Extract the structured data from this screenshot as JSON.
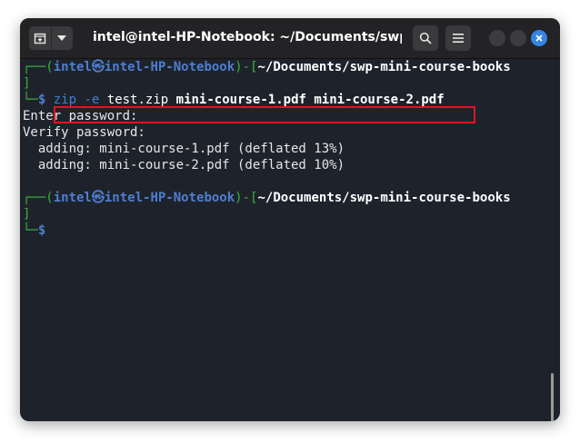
{
  "window": {
    "title": "intel@intel-HP-Notebook: ~/Documents/swp...",
    "new_tab_icon": "new-tab-icon",
    "menu_dropdown_icon": "chevron-down-icon",
    "search_icon": "search-icon",
    "hamburger_icon": "hamburger-menu-icon",
    "close_icon": "close-icon"
  },
  "prompt1": {
    "corner_top": "┌──(",
    "user": "intel",
    "symbol": "㉿",
    "host": "intel-HP-Notebook",
    "sep": ")-[",
    "path": "~/Documents/swp-mini-course-books",
    "bar": "]",
    "corner_bottom": "└─",
    "dollar": "$",
    "command": {
      "cmd": "zip",
      "flag": "-e",
      "archive": "test.zip",
      "file1": "mini-course-1.pdf",
      "file2": "mini-course-2.pdf"
    }
  },
  "output": [
    "Enter password:",
    "Verify password:",
    "  adding: mini-course-1.pdf (deflated 13%)",
    "  adding: mini-course-2.pdf (deflated 10%)"
  ],
  "prompt2": {
    "corner_top": "┌──(",
    "user": "intel",
    "symbol": "㉿",
    "host": "intel-HP-Notebook",
    "sep": ")-[",
    "path": "~/Documents/swp-mini-course-books",
    "bar": "]",
    "corner_bottom": "└─",
    "dollar": "$"
  },
  "colors": {
    "prompt_green": "#3cb043",
    "prompt_blue": "#4e7ecf",
    "highlight_red": "#e0141e",
    "background": "#1e232b"
  }
}
